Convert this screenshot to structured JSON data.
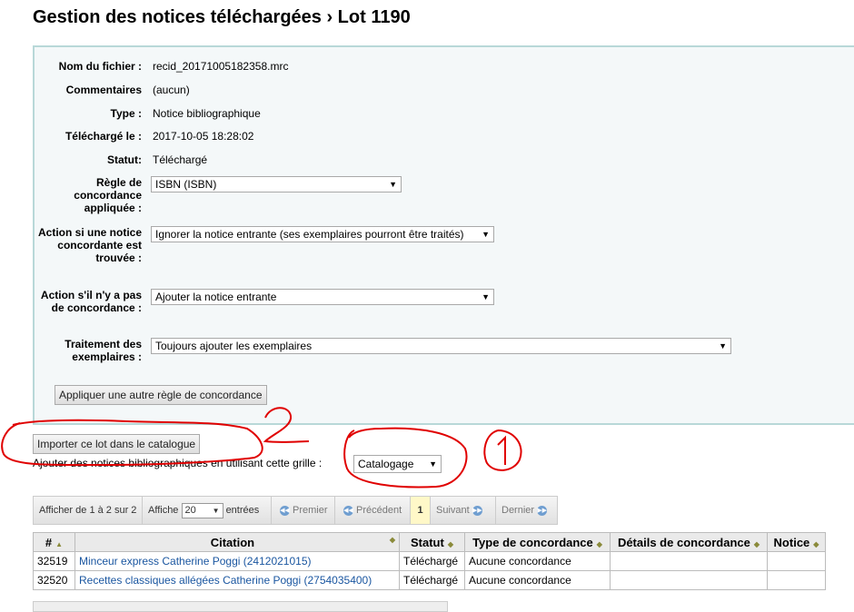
{
  "page": {
    "title": "Gestion des notices téléchargées › Lot 1190"
  },
  "fields": {
    "filename_label": "Nom du fichier :",
    "filename": "recid_20171005182358.mrc",
    "comments_label": "Commentaires",
    "comments": "(aucun)",
    "type_label": "Type :",
    "type": "Notice bibliographique",
    "uploaded_label": "Téléchargé le :",
    "uploaded": "2017-10-05 18:28:02",
    "status_label": "Statut:",
    "status": "Téléchargé",
    "rule_label": "Règle de concordance appliquée :",
    "rule_value": "ISBN (ISBN)",
    "action_match_label": "Action si une notice concordante est trouvée :",
    "action_match_value": "Ignorer la notice entrante (ses exemplaires pourront être traités)",
    "action_nomatch_label": "Action s'il n'y a pas de concordance :",
    "action_nomatch_value": "Ajouter la notice entrante",
    "items_label": "Traitement des exemplaires :",
    "items_value": "Toujours ajouter les exemplaires",
    "apply_rule_button": "Appliquer une autre règle de concordance"
  },
  "import": {
    "button": "Importer ce lot dans le catalogue",
    "framework_text": "Ajouter des notices bibliographiques en utilisant cette grille :",
    "framework_value": "Catalogage"
  },
  "annotations": {
    "circle_1": "1",
    "circle_2": "2"
  },
  "pager": {
    "info": "Afficher de 1 à 2 sur 2",
    "show": "Affiche",
    "per_page": "20",
    "entries": "entrées",
    "first": "Premier",
    "prev": "Précédent",
    "current": "1",
    "next": "Suivant",
    "last": "Dernier"
  },
  "table": {
    "headers": [
      "#",
      "Citation",
      "Statut",
      "Type de concordance",
      "Détails de concordance",
      "Notice"
    ],
    "rows": [
      {
        "id": "32519",
        "citation": "Minceur express Catherine Poggi (2412021015)",
        "status": "Téléchargé",
        "match": "Aucune concordance",
        "details": "",
        "record": ""
      },
      {
        "id": "32520",
        "citation": "Recettes classiques allégées Catherine Poggi (2754035400)",
        "status": "Téléchargé",
        "match": "Aucune concordance",
        "details": "",
        "record": ""
      }
    ]
  }
}
